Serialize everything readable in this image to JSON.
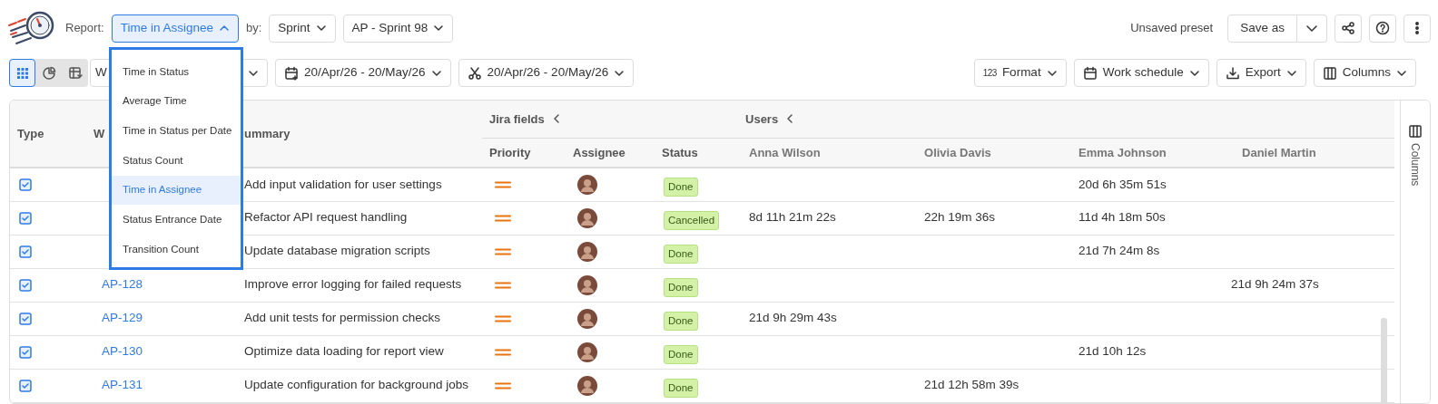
{
  "toolbar": {
    "report_label": "Report:",
    "report_select": {
      "value": "Time in Assignee",
      "expanded": true
    },
    "by_label": "by:",
    "group_select": "Sprint",
    "sprint_select": "AP - Sprint 98",
    "preset_status": "Unsaved preset",
    "save_button": "Save as"
  },
  "report_menu": [
    {
      "label": "Time in Status",
      "selected": false
    },
    {
      "label": "Average Time",
      "selected": false
    },
    {
      "label": "Time in Status per Date",
      "selected": false
    },
    {
      "label": "Status Count",
      "selected": false
    },
    {
      "label": "Time in Assignee",
      "selected": true
    },
    {
      "label": "Status Entrance Date",
      "selected": false
    },
    {
      "label": "Transition Count",
      "selected": false
    }
  ],
  "view_toggle": [
    {
      "kind": "grid",
      "selected": true
    },
    {
      "kind": "chart",
      "selected": false
    },
    {
      "kind": "calendar",
      "selected": false
    }
  ],
  "period_select": "W",
  "date_filters": [
    {
      "kind": "calendar",
      "label": "20/Apr/26 - 20/May/26"
    },
    {
      "kind": "cut",
      "label": "20/Apr/26 - 20/May/26"
    }
  ],
  "actions": [
    {
      "kind": "format",
      "icon_text": "123",
      "label": "Format"
    },
    {
      "kind": "calendar",
      "label": "Work schedule"
    },
    {
      "kind": "export",
      "label": "Export"
    },
    {
      "kind": "columns",
      "label": "Columns"
    }
  ],
  "table": {
    "type_header": "Type",
    "key_header": "W",
    "summary_header": "ummary",
    "groups": [
      {
        "label": "Jira fields"
      },
      {
        "label": "Users"
      }
    ],
    "field_columns": [
      "Priority",
      "Assignee",
      "Status"
    ],
    "user_columns": [
      "Anna Wilson",
      "Olivia Davis",
      "Emma Johnson",
      "Daniel Martin"
    ],
    "rows": [
      {
        "summary": "Add input validation for user settings",
        "status": "Done",
        "times": {
          "user_3": "20d 6h 35m 51s"
        }
      },
      {
        "summary": "Refactor API request handling",
        "status": "Cancelled",
        "times": {
          "user_1": "8d 11h 21m 22s",
          "user_2": "22h 19m 36s",
          "user_3": "11d 4h 18m 50s"
        }
      },
      {
        "summary": "Update database migration scripts",
        "status": "Done",
        "times": {
          "user_3": "21d 7h 24m 8s"
        }
      },
      {
        "key": "AP-128",
        "summary": "Improve error logging for failed requests",
        "status": "Done",
        "times": {
          "user_4": "21d 9h 24m 37s"
        }
      },
      {
        "key": "AP-129",
        "summary": "Add unit tests for permission checks",
        "status": "Done",
        "times": {
          "user_1": "21d 9h 29m 43s"
        }
      },
      {
        "key": "AP-130",
        "summary": "Optimize data loading for report view",
        "status": "Done",
        "times": {
          "user_3": "21d 10h 12s"
        }
      },
      {
        "key": "AP-131",
        "summary": "Update configuration for background jobs",
        "status": "Done",
        "times": {
          "user_2": "21d 12h 58m 39s"
        }
      }
    ]
  },
  "side_panel": {
    "label": "Columns"
  }
}
